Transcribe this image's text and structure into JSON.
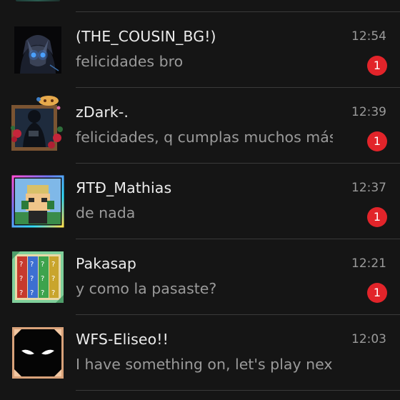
{
  "conversations": [
    {
      "name": "(THE_COUSIN_BG!)",
      "preview": "felicidades bro",
      "time": "12:54",
      "unread": "1",
      "avatar_icon": "anime-character-avatar"
    },
    {
      "name": "zDark-.",
      "preview": "felicidades, q cumplas muchos más",
      "time": "12:39",
      "unread": "1",
      "avatar_icon": "framed-portrait-with-roses-avatar"
    },
    {
      "name": "ЯТĐ_Mathias",
      "preview": "de nada",
      "time": "12:37",
      "unread": "1",
      "avatar_icon": "blocky-character-neon-frame-avatar"
    },
    {
      "name": "Pakasap",
      "preview": "y como la pasaste?",
      "time": "12:21",
      "unread": "1",
      "avatar_icon": "lucky-blocks-avatar"
    },
    {
      "name": "WFS-Eliseo!!",
      "preview": "I have something on, let's play next ...",
      "time": "12:03",
      "unread": "",
      "avatar_icon": "glowing-eyes-avatar"
    }
  ],
  "colors": {
    "background": "#151515",
    "name_text": "#ececec",
    "secondary_text": "#9a9a9a",
    "divider": "#3a3a3a",
    "badge": "#e2242a"
  }
}
